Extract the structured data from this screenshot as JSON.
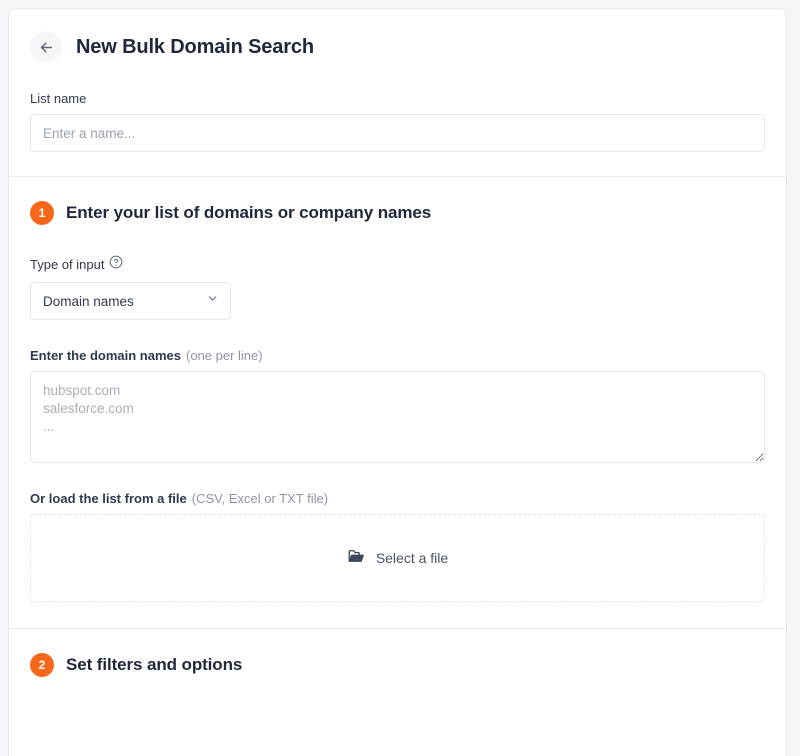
{
  "header": {
    "back_icon": "arrow-left-icon",
    "title": "New Bulk Domain Search",
    "list_name_label": "List name",
    "list_name_value": "",
    "list_name_placeholder": "Enter a name..."
  },
  "step1": {
    "badge": "1",
    "title": "Enter your list of domains or company names",
    "type_of_input": {
      "label": "Type of input",
      "help_icon": "question-circle-icon",
      "selected": "Domain names",
      "chevron_icon": "chevron-down-icon",
      "options": [
        "Domain names"
      ]
    },
    "domains": {
      "label_main": "Enter the domain names",
      "label_muted": "(one per line)",
      "value": "",
      "placeholder": "hubspot.com\nsalesforce.com\n..."
    },
    "file": {
      "label_main": "Or load the list from a file",
      "label_muted": "(CSV, Excel or TXT file)",
      "folder_icon": "folder-open-icon",
      "button_label": "Select a file"
    }
  },
  "step2": {
    "badge": "2",
    "title": "Set filters and options"
  },
  "colors": {
    "accent": "#f86719",
    "title": "#20293b",
    "text": "#2f3a4d",
    "muted": "#8d95a5",
    "border": "#e4e6ec",
    "page_bg": "#f4f6f9"
  }
}
